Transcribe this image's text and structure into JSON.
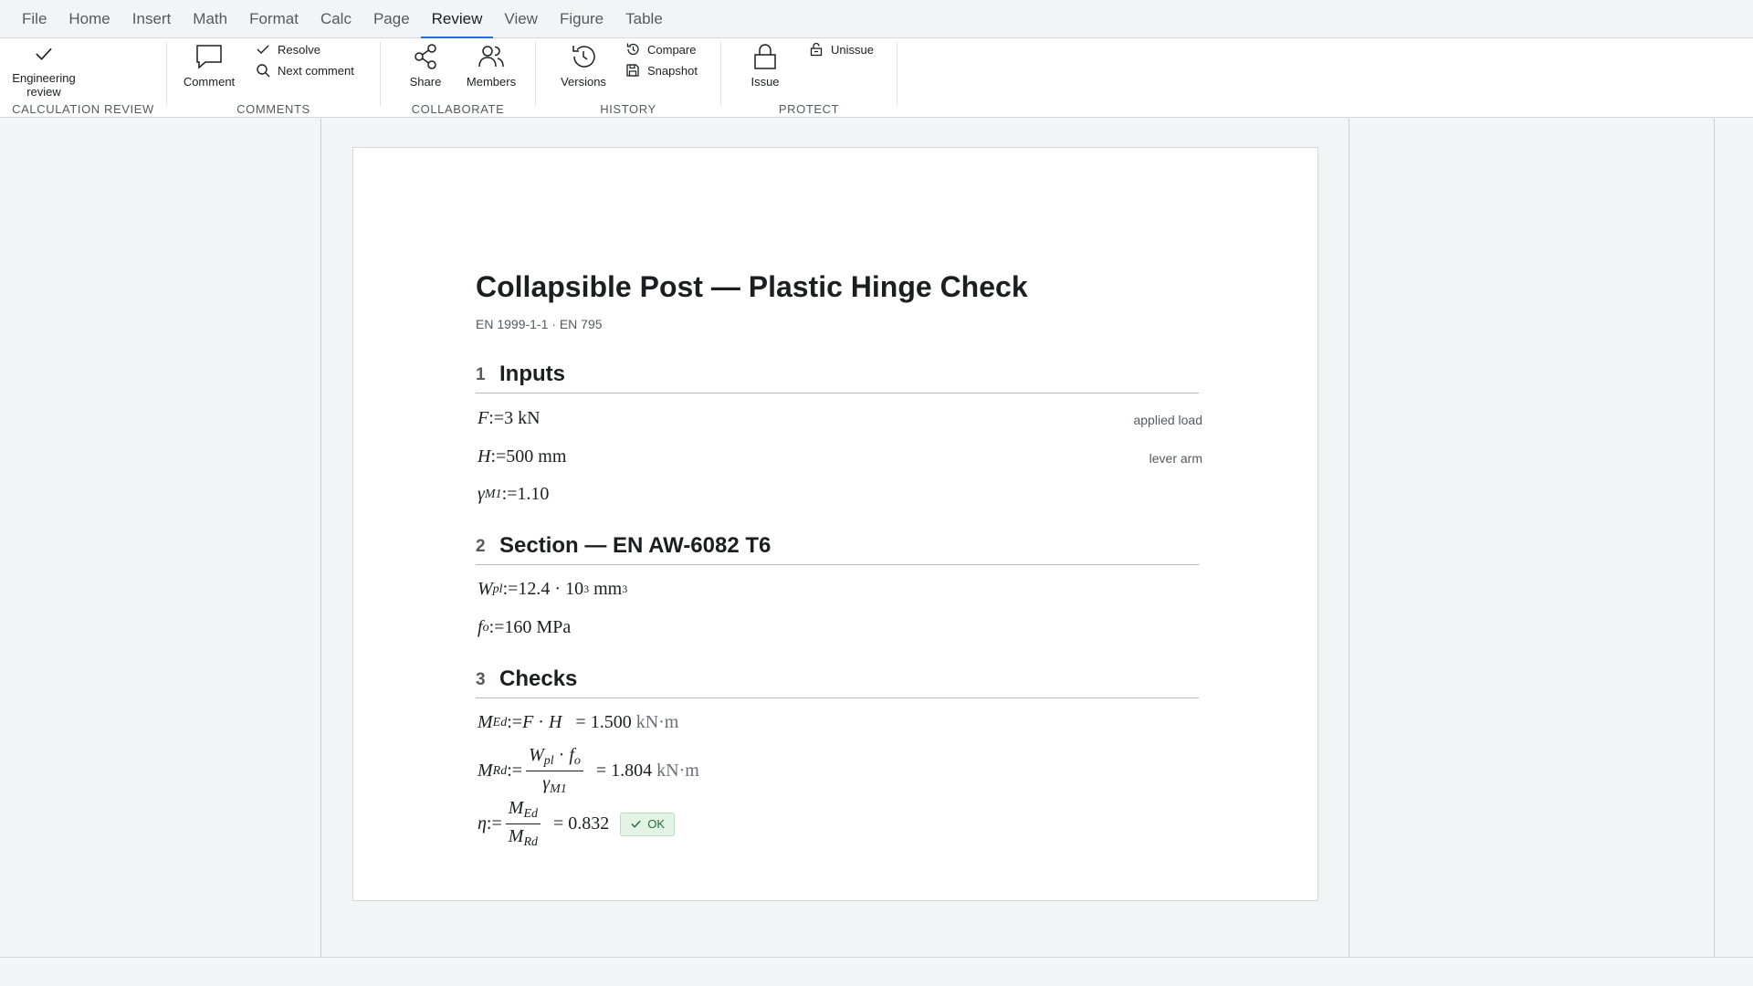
{
  "menu": {
    "items": [
      "File",
      "Home",
      "Insert",
      "Math",
      "Format",
      "Calc",
      "Page",
      "Review",
      "View",
      "Figure",
      "Table"
    ],
    "active": "Review"
  },
  "ribbon": {
    "calculation_review": {
      "label": "CALCULATION REVIEW",
      "engineering_review_line1": "Engineering",
      "engineering_review_line2": "review"
    },
    "comments": {
      "label": "COMMENTS",
      "comment": "Comment",
      "resolve": "Resolve",
      "next_comment": "Next comment"
    },
    "collaborate": {
      "label": "COLLABORATE",
      "share": "Share",
      "members": "Members"
    },
    "history": {
      "label": "HISTORY",
      "versions": "Versions",
      "compare": "Compare",
      "snapshot": "Snapshot"
    },
    "protect": {
      "label": "PROTECT",
      "issue": "Issue",
      "unissue": "Unissue"
    }
  },
  "document": {
    "title": "Collapsible Post — Plastic Hinge Check",
    "subtitle": "EN 1999-1-1 · EN 795",
    "sections": [
      {
        "num": "1",
        "title": "Inputs"
      },
      {
        "num": "2",
        "title": "Section — EN AW-6082 T6"
      },
      {
        "num": "3",
        "title": "Checks"
      }
    ],
    "inputs": {
      "F": {
        "sym": "F",
        "assign": ":=",
        "value": "3",
        "unit": "kN",
        "note": "applied load"
      },
      "H": {
        "sym": "H",
        "assign": ":=",
        "value": "500",
        "unit": "mm",
        "note": "lever arm"
      },
      "gamma": {
        "sym": "γ",
        "sub": "M1",
        "assign": ":=",
        "value": "1.10"
      }
    },
    "section": {
      "Wpl": {
        "sym": "W",
        "sub": "pl",
        "assign": ":=",
        "mantissa": "12.4 · 10",
        "exp": "3",
        "unit": "mm",
        "unit_exp": "3"
      },
      "fo": {
        "sym": "f",
        "sub": "o",
        "assign": ":=",
        "value": "160",
        "unit": "MPa"
      }
    },
    "checks": {
      "MEd": {
        "sym": "M",
        "sub": "Ed",
        "assign": ":=",
        "expr_a": "F",
        "dot": "·",
        "expr_b": "H",
        "eq": "=",
        "result": "1.500",
        "unit": "kN·m"
      },
      "MRd": {
        "sym": "M",
        "sub": "Rd",
        "assign": ":=",
        "num_a": "W",
        "num_a_sub": "pl",
        "dot": "·",
        "num_b": "f",
        "num_b_sub": "o",
        "den": "γ",
        "den_sub": "M1",
        "eq": "=",
        "result": "1.804",
        "unit": "kN·m"
      },
      "eta": {
        "sym": "η",
        "assign": ":=",
        "num": "M",
        "num_sub": "Ed",
        "den": "M",
        "den_sub": "Rd",
        "eq": "=",
        "result": "0.832",
        "status": "OK"
      }
    }
  },
  "colors": {
    "accent": "#2b6cd9",
    "ok_bg": "#e3f3e6",
    "ok_text": "#1f6b32"
  }
}
